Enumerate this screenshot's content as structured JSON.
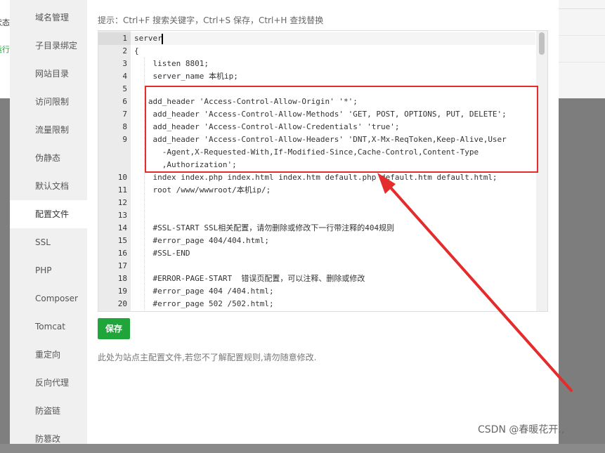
{
  "background": {
    "left_row1": "状态",
    "left_row2": "运行"
  },
  "sidebar": {
    "items": [
      {
        "label": "域名管理"
      },
      {
        "label": "子目录绑定"
      },
      {
        "label": "网站目录"
      },
      {
        "label": "访问限制"
      },
      {
        "label": "流量限制"
      },
      {
        "label": "伪静态"
      },
      {
        "label": "默认文档"
      },
      {
        "label": "配置文件",
        "active": true
      },
      {
        "label": "SSL"
      },
      {
        "label": "PHP"
      },
      {
        "label": "Composer"
      },
      {
        "label": "Tomcat"
      },
      {
        "label": "重定向"
      },
      {
        "label": "反向代理"
      },
      {
        "label": "防盗链"
      },
      {
        "label": "防篡改"
      }
    ]
  },
  "editor": {
    "tip": "提示：Ctrl+F 搜索关键字，Ctrl+S 保存，Ctrl+H 查找替换",
    "line_numbers": [
      "1",
      "2",
      "3",
      "4",
      "5",
      "6",
      "7",
      "8",
      "9",
      "",
      "",
      "10",
      "11",
      "12",
      "13",
      "14",
      "15",
      "16",
      "17",
      "18",
      "19",
      "20"
    ],
    "lines": [
      "server",
      "{",
      "    listen 8801;",
      "    server_name 本机ip;",
      "",
      "   add_header 'Access-Control-Allow-Origin' '*';",
      "    add_header 'Access-Control-Allow-Methods' 'GET, POST, OPTIONS, PUT, DELETE';",
      "    add_header 'Access-Control-Allow-Credentials' 'true';",
      "    add_header 'Access-Control-Allow-Headers' 'DNT,X-Mx-ReqToken,Keep-Alive,User",
      "      -Agent,X-Requested-With,If-Modified-Since,Cache-Control,Content-Type",
      "      ,Authorization';",
      "    index index.php index.html index.htm default.php default.htm default.html;",
      "    root /www/wwwroot/本机ip/;",
      "",
      "",
      "    #SSL-START SSL相关配置，请勿删除或修改下一行带注释的404规则",
      "    #error_page 404/404.html;",
      "    #SSL-END",
      "",
      "    #ERROR-PAGE-START  错误页配置，可以注释、删除或修改",
      "    #error_page 404 /404.html;",
      "    #error_page 502 /502.html;"
    ]
  },
  "save_button": "保存",
  "note": "此处为站点主配置文件,若您不了解配置规则,请勿随意修改.",
  "watermark": "CSDN @春暖花开.,",
  "colors": {
    "accent": "#20a53a",
    "annotation": "#e42c2c"
  }
}
